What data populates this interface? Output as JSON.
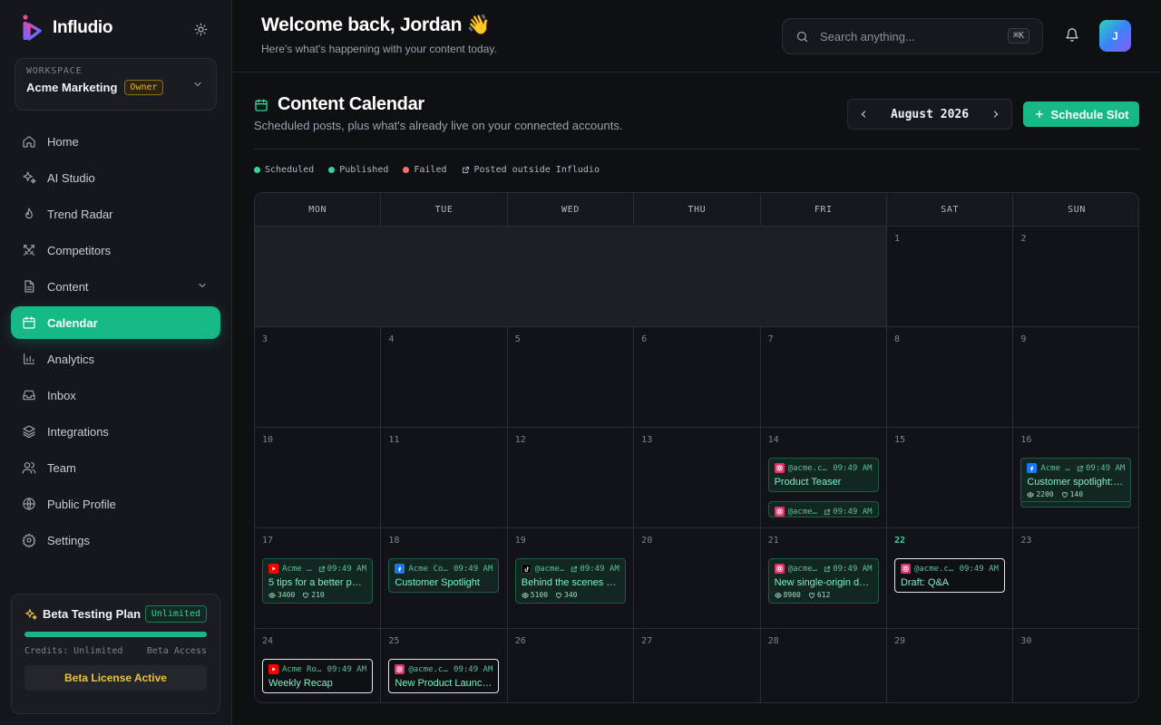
{
  "brand": {
    "name": "Infludio"
  },
  "workspace": {
    "label": "WORKSPACE",
    "name": "Acme Marketing",
    "role": "Owner"
  },
  "nav": [
    {
      "label": "Home",
      "icon": "home-icon"
    },
    {
      "label": "AI Studio",
      "icon": "sparkles-icon"
    },
    {
      "label": "Trend Radar",
      "icon": "flame-icon"
    },
    {
      "label": "Competitors",
      "icon": "swords-icon"
    },
    {
      "label": "Content",
      "icon": "document-icon",
      "expandable": true
    },
    {
      "label": "Calendar",
      "icon": "calendar-icon",
      "active": true
    },
    {
      "label": "Analytics",
      "icon": "bar-chart-icon"
    },
    {
      "label": "Inbox",
      "icon": "inbox-icon"
    },
    {
      "label": "Integrations",
      "icon": "layers-icon"
    },
    {
      "label": "Team",
      "icon": "users-icon"
    },
    {
      "label": "Public Profile",
      "icon": "globe-icon"
    },
    {
      "label": "Settings",
      "icon": "gear-icon"
    }
  ],
  "plan": {
    "title": "Beta Testing Plan",
    "badge": "Unlimited",
    "credits": "Credits: Unlimited",
    "access": "Beta Access",
    "button": "Beta License Active",
    "progress": 1.0
  },
  "header": {
    "welcome": "Welcome back, Jordan 👋",
    "subtitle": "Here's what's happening with your content today."
  },
  "search": {
    "placeholder": "Search anything...",
    "shortcut": "⌘K"
  },
  "user": {
    "initial": "J"
  },
  "calendar": {
    "title": "Content Calendar",
    "subtitle": "Scheduled posts, plus what's already live on your connected accounts.",
    "month": "August 2026",
    "schedule_button": "Schedule Slot",
    "legend": [
      {
        "label": "Scheduled",
        "color": "#34d399"
      },
      {
        "label": "Published",
        "color": "#34d399"
      },
      {
        "label": "Failed",
        "color": "#f87171"
      },
      {
        "label": "Posted outside Infludio",
        "icon": "external-link-icon"
      }
    ],
    "days_of_week": [
      "MON",
      "TUE",
      "WED",
      "THU",
      "FRI",
      "SAT",
      "SUN"
    ],
    "today": 22,
    "weeks": [
      [
        null,
        null,
        null,
        null,
        null,
        1,
        2
      ],
      [
        3,
        4,
        5,
        6,
        7,
        8,
        9
      ],
      [
        10,
        11,
        12,
        13,
        14,
        15,
        16
      ],
      [
        17,
        18,
        19,
        20,
        21,
        22,
        23
      ],
      [
        24,
        25,
        26,
        27,
        28,
        29,
        30
      ]
    ],
    "posts": [
      {
        "day": 14,
        "slot": 0,
        "platform": "instagram",
        "account": "@acme.co…",
        "time": "09:49 AM",
        "external": false,
        "title": "Product Teaser",
        "status": "published"
      },
      {
        "day": 14,
        "slot": 1,
        "platform": "instagram",
        "account": "@acme…",
        "time": "09:49 AM",
        "external": true,
        "title": "",
        "status": "published",
        "clipped": true
      },
      {
        "day": 16,
        "slot": 0,
        "platform": "facebook",
        "account": "Acme …",
        "time": "09:49 AM",
        "external": true,
        "title": "Customer spotlight: …",
        "views": "2200",
        "likes": "140",
        "status": "published"
      },
      {
        "day": 16,
        "slot": 1,
        "platform": "facebook",
        "account": "",
        "time": "",
        "external": false,
        "title": "",
        "status": "published",
        "clipped": true
      },
      {
        "day": 17,
        "slot": 0,
        "platform": "youtube",
        "account": "Acme …",
        "time": "09:49 AM",
        "external": true,
        "title": "5 tips for a better po…",
        "views": "3400",
        "likes": "210",
        "status": "published"
      },
      {
        "day": 18,
        "slot": 0,
        "platform": "facebook",
        "account": "Acme Cof…",
        "time": "09:49 AM",
        "external": false,
        "title": "Customer Spotlight",
        "status": "published"
      },
      {
        "day": 19,
        "slot": 0,
        "platform": "tiktok",
        "account": "@acme…",
        "time": "09:49 AM",
        "external": true,
        "title": "Behind the scenes of…",
        "views": "5100",
        "likes": "340",
        "status": "published"
      },
      {
        "day": 21,
        "slot": 0,
        "platform": "instagram",
        "account": "@acme…",
        "time": "09:49 AM",
        "external": true,
        "title": "New single-origin dr…",
        "views": "8900",
        "likes": "612",
        "status": "published"
      },
      {
        "day": 22,
        "slot": 0,
        "platform": "instagram",
        "account": "@acme.co…",
        "time": "09:49 AM",
        "external": false,
        "title": "Draft: Q&A",
        "status": "draft"
      },
      {
        "day": 24,
        "slot": 0,
        "platform": "youtube",
        "account": "Acme Roa…",
        "time": "09:49 AM",
        "external": false,
        "title": "Weekly Recap",
        "status": "draft"
      },
      {
        "day": 25,
        "slot": 0,
        "platform": "instagram",
        "account": "@acme.co…",
        "time": "09:49 AM",
        "external": false,
        "title": "New Product Launch …",
        "status": "draft"
      }
    ]
  },
  "colors": {
    "accent": "#16b986",
    "background": "#0f1014",
    "sidebar": "#15171c",
    "warning": "#e3b341"
  }
}
